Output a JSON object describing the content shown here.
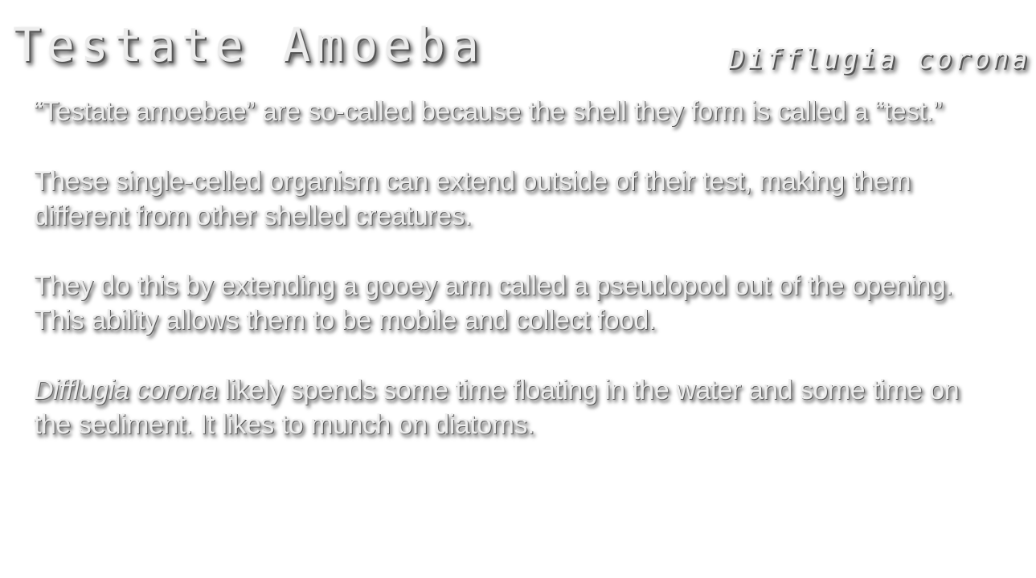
{
  "header": {
    "title": "Testate Amoeba",
    "subtitle": "Difflugia corona"
  },
  "paragraphs": {
    "p1": "“Testate amoebae” are so-called because the shell they form is called a “test.”",
    "p2": "These single-celled organism can extend outside of their test, making them different from other shelled creatures.",
    "p3": "They do this by extending a gooey arm called a pseudopod out of the opening. This ability allows them to be mobile and collect food.",
    "p4_italic": "Difflugia corona",
    "p4_rest": " likely spends some time floating in the water and some time on the sediment. It likes to munch on diatoms."
  }
}
